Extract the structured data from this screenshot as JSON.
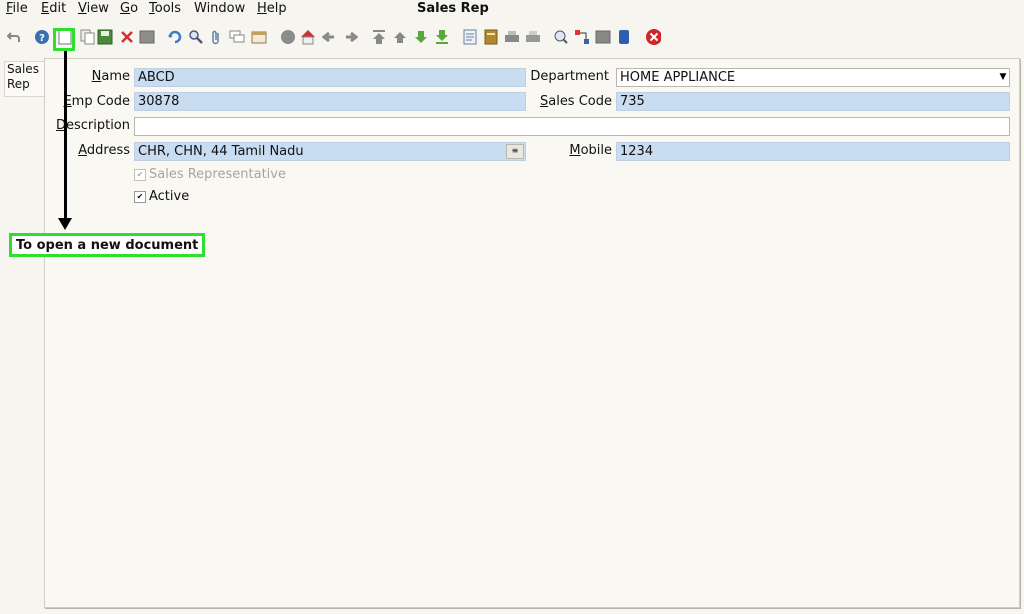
{
  "window": {
    "title": "Sales Rep"
  },
  "menu": [
    {
      "label": "File",
      "underline": "F",
      "rest": "ile"
    },
    {
      "label": "Edit",
      "underline": "E",
      "rest": "dit"
    },
    {
      "label": "View",
      "underline": "V",
      "rest": "iew"
    },
    {
      "label": "Go",
      "underline": "G",
      "rest": "o"
    },
    {
      "label": "Tools",
      "underline": "T",
      "rest": "ools"
    },
    {
      "label": "Window",
      "underline": "",
      "rest": "Window"
    },
    {
      "label": "Help",
      "underline": "H",
      "rest": "elp"
    }
  ],
  "tabs": {
    "sales_rep_line1": "Sales",
    "sales_rep_line2": "Rep"
  },
  "form": {
    "name": {
      "label_u": "N",
      "label_rest": "ame",
      "value": "ABCD"
    },
    "emp_code": {
      "label_u": "E",
      "label_rest": "mp Code",
      "value": "30878"
    },
    "description": {
      "label_u": "D",
      "label_rest": "escription",
      "value": ""
    },
    "address": {
      "label_u": "A",
      "label_rest": "ddress",
      "value": "CHR, CHN,  44 Tamil Nadu",
      "button": "≡"
    },
    "department": {
      "label": "Department",
      "value": "HOME APPLIANCE",
      "arrow": "▼"
    },
    "sales_code": {
      "label_u": "S",
      "label_rest": "ales Code",
      "value": "735"
    },
    "mobile": {
      "label_u": "M",
      "label_rest": "obile",
      "value": "1234"
    },
    "sales_representative": {
      "label": "Sales Representative",
      "checked": true
    },
    "active": {
      "label": "Active",
      "checked": true
    }
  },
  "annotation": {
    "text": "To open a new document",
    "color": "#2ee02e"
  },
  "toolbar_icons": [
    "undo-icon",
    "help-icon",
    "new-document-icon",
    "copy-record-icon",
    "save-icon",
    "delete-icon",
    "ignore-icon",
    "refresh-icon",
    "find-icon",
    "attachment-icon",
    "chat-icon",
    "history-icon",
    "requests-icon",
    "home-icon",
    "previous-icon",
    "next-icon",
    "first-record-icon",
    "previous-record-icon",
    "next-record-icon",
    "last-record-icon",
    "report-icon",
    "archive-icon",
    "print-icon",
    "print-preview-icon",
    "zoom-across-icon",
    "workflow-icon",
    "product-info-icon",
    "end-icon",
    "close-icon"
  ],
  "colors": {
    "field_blue": "#c9ddf2",
    "background": "#f7f5ef",
    "accent_green": "#2ee02e"
  }
}
